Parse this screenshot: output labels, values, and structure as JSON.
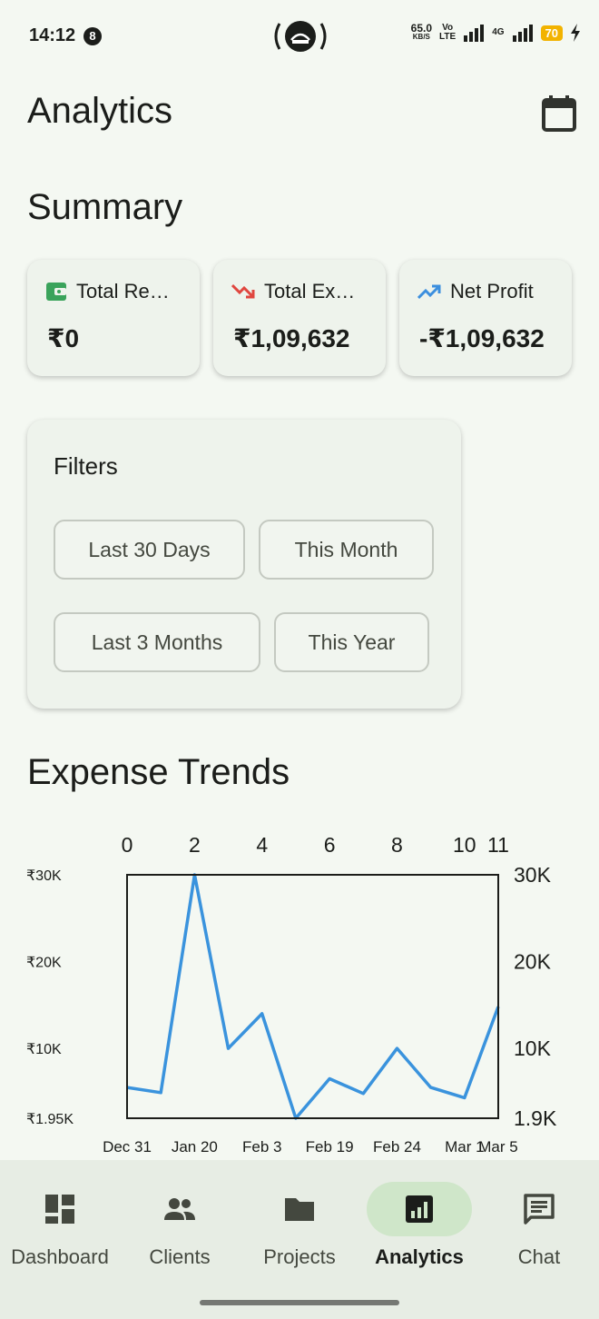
{
  "status_bar": {
    "time": "14:12",
    "notification_count": "8",
    "net_speed_value": "65.0",
    "net_speed_unit": "KB/S",
    "volte_top": "Vo",
    "volte_bottom": "LTE",
    "network_type": "4G",
    "battery": "70"
  },
  "header": {
    "title": "Analytics"
  },
  "summary": {
    "title": "Summary",
    "cards": [
      {
        "label": "Total Re…",
        "value": "₹0",
        "icon": "wallet-icon",
        "color": "#3aa35b"
      },
      {
        "label": "Total Ex…",
        "value": "₹1,09,632",
        "icon": "trending-down-icon",
        "color": "#e0463f"
      },
      {
        "label": "Net Profit",
        "value": "-₹1,09,632",
        "icon": "trending-up-icon",
        "color": "#3c8fde"
      }
    ]
  },
  "filters": {
    "title": "Filters",
    "chips": [
      "Last 30 Days",
      "This Month",
      "Last 3 Months",
      "This Year"
    ]
  },
  "expense_trends": {
    "title": "Expense Trends"
  },
  "chart_data": {
    "type": "line",
    "title": "Expense Trends",
    "series_color": "#3a93dd",
    "x": [
      0,
      1,
      2,
      3,
      4,
      5,
      6,
      7,
      8,
      9,
      10,
      11
    ],
    "values": [
      5500,
      4900,
      30000,
      10000,
      14000,
      1950,
      6500,
      4800,
      10000,
      5500,
      4300,
      14800
    ],
    "xlim": [
      0,
      11
    ],
    "ylim": [
      1950,
      30000
    ],
    "x_top_ticks": [
      "0",
      "2",
      "4",
      "6",
      "8",
      "10",
      "11"
    ],
    "x_top_tick_values": [
      0,
      2,
      4,
      6,
      8,
      10,
      11
    ],
    "x_bottom_labels": [
      "Dec 31",
      "Jan 20",
      "Feb 3",
      "Feb 19",
      "Feb 24",
      "Mar 1",
      "Mar 5"
    ],
    "x_bottom_label_values": [
      0,
      2,
      4,
      6,
      8,
      10,
      11
    ],
    "y_left_ticks": [
      "₹30K",
      "₹20K",
      "₹10K",
      "₹1.95K"
    ],
    "y_right_ticks": [
      "30K",
      "20K",
      "10K",
      "1.9K"
    ],
    "y_tick_values": [
      30000,
      20000,
      10000,
      1950
    ]
  },
  "bottom_nav": {
    "items": [
      {
        "label": "Dashboard",
        "icon": "dashboard-icon",
        "active": false
      },
      {
        "label": "Clients",
        "icon": "people-icon",
        "active": false
      },
      {
        "label": "Projects",
        "icon": "folder-icon",
        "active": false
      },
      {
        "label": "Analytics",
        "icon": "analytics-icon",
        "active": true
      },
      {
        "label": "Chat",
        "icon": "chat-icon",
        "active": false
      }
    ]
  }
}
